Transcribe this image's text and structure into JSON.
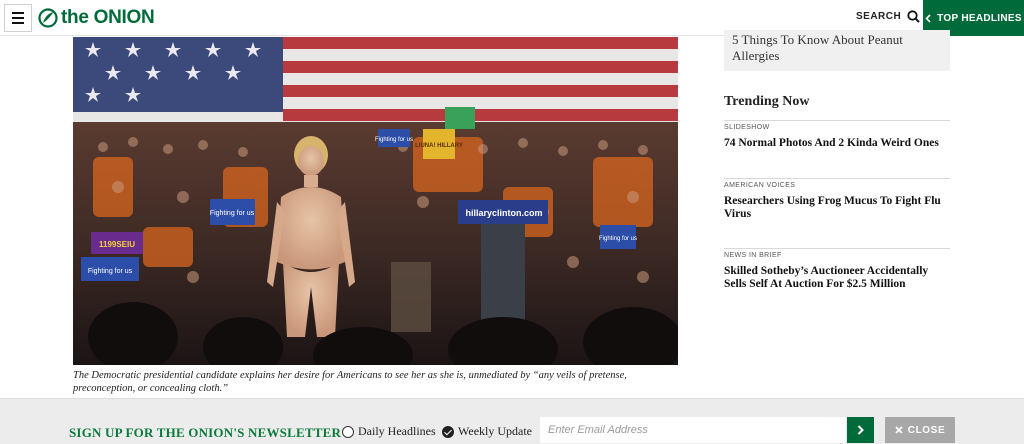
{
  "header": {
    "menu_icon": "hamburger-menu-icon",
    "logo_text_prefix": "the",
    "logo_text_main": "ONION",
    "logo_icon": "onion-leaf-logo-icon",
    "search_label": "SEARCH",
    "search_icon": "search-icon",
    "top_headlines_label": "TOP HEADLINES",
    "top_headlines_icon": "chevron-left-icon",
    "accent_color": "#006b3a"
  },
  "article": {
    "photo_signs": {
      "podium": "hillaryclinton.com",
      "sign_fighting": "Fighting for us",
      "sign_seiu": "1199SEIU",
      "sign_fighting2": "Fighting for us",
      "sign_fighting3": "Fighting for us",
      "sign_liuna": "LIUNA! HILLARY",
      "sign_fighting4": "Fighting for us"
    },
    "caption": "The Democratic presidential candidate explains her desire for Americans to see her as she is, unmediated by “any veils of pretense, preconception, or concealing cloth.”"
  },
  "sidebar": {
    "previous_card_title": "5 Things To Know About Peanut Allergies",
    "trending_heading": "Trending Now",
    "trending": [
      {
        "kicker": "SLIDESHOW",
        "title": "74 Normal Photos And 2 Kinda Weird Ones"
      },
      {
        "kicker": "AMERICAN VOICES",
        "title": "Researchers Using Frog Mucus To Fight Flu Virus"
      },
      {
        "kicker": "NEWS IN BRIEF",
        "title": "Skilled Sotheby’s Auctioneer Accidentally Sells Self At Auction For $2.5 Million"
      }
    ]
  },
  "newsletter": {
    "title": "SIGN UP FOR THE ONION'S NEWSLETTER",
    "options": [
      {
        "label": "Daily Headlines",
        "checked": false
      },
      {
        "label": "Weekly Update",
        "checked": true
      }
    ],
    "email_placeholder": "Enter Email Address",
    "submit_icon": "chevron-right-icon",
    "close_label": "CLOSE",
    "close_icon": "close-x-icon",
    "title_color": "#0b7a3a"
  }
}
